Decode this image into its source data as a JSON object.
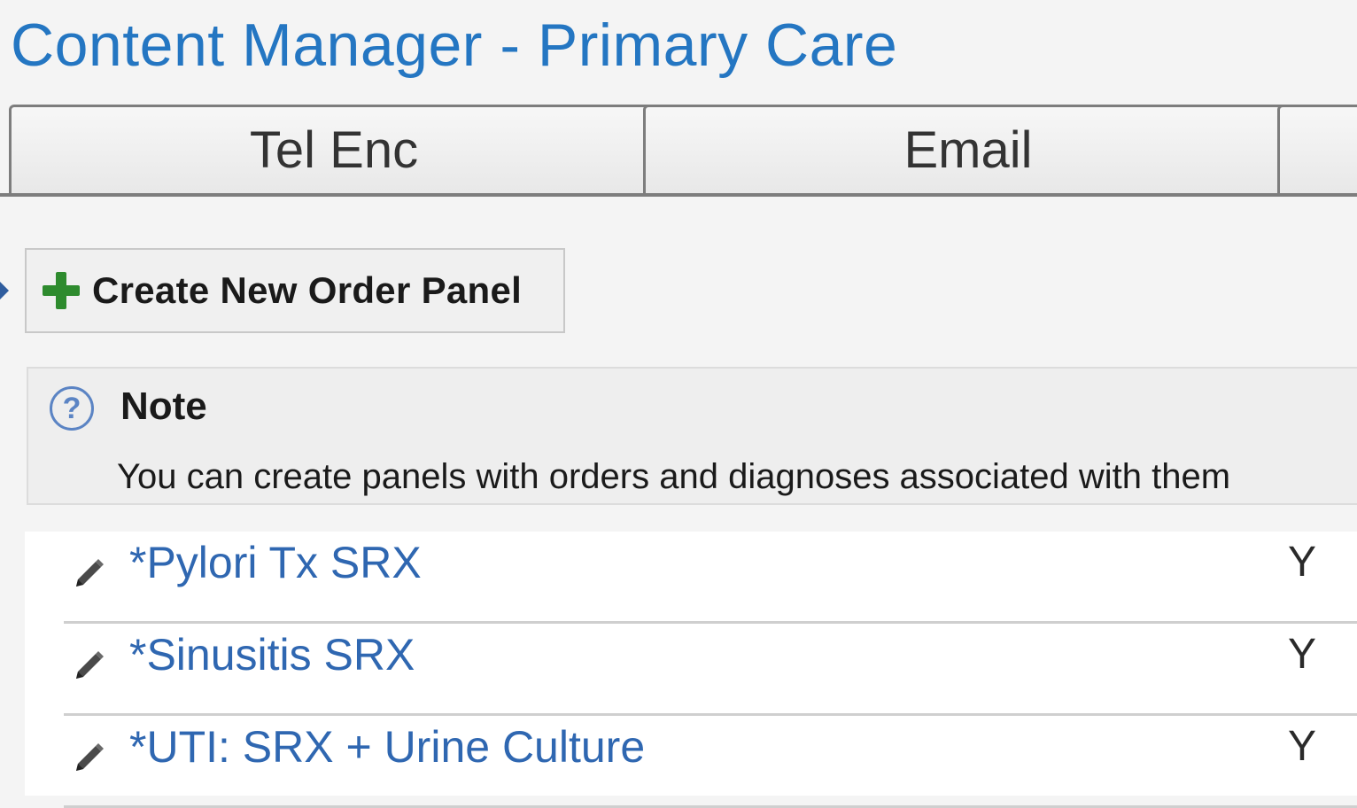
{
  "app": {
    "title": "Content Manager - Primary Care"
  },
  "tabs": [
    {
      "label": "Tel Enc"
    },
    {
      "label": "Email"
    },
    {
      "label": ""
    }
  ],
  "toolbar": {
    "create_label": "Create New Order Panel"
  },
  "note": {
    "title": "Note",
    "text": "You can create panels with orders and diagnoses associated with them"
  },
  "panels": [
    {
      "name": "*Pylori Tx SRX",
      "flag": "Y"
    },
    {
      "name": "*Sinusitis SRX",
      "flag": "Y"
    },
    {
      "name": "*UTI: SRX + Urine Culture",
      "flag": "Y"
    }
  ],
  "colors": {
    "title": "#2476c2",
    "link": "#2f67b1",
    "plus": "#2e8b2e"
  }
}
